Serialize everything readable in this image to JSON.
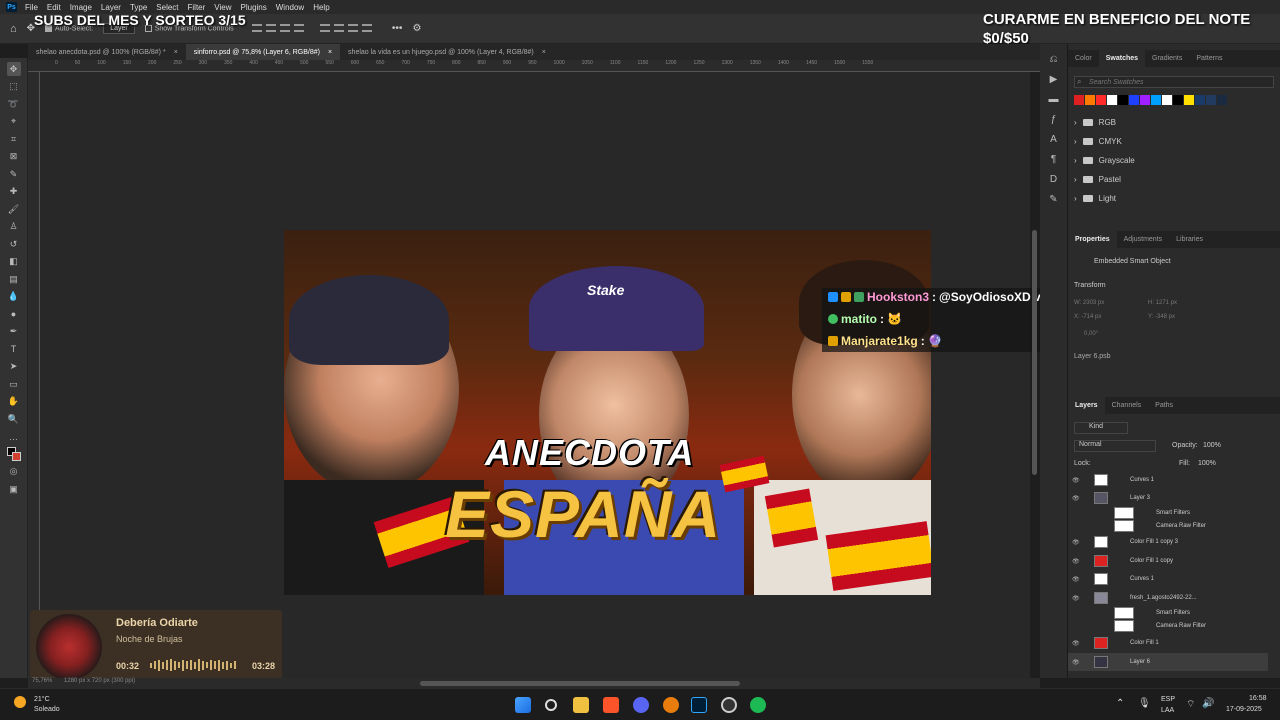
{
  "menubar": {
    "app_icon": "Ps",
    "items": [
      "File",
      "Edit",
      "Image",
      "Layer",
      "Type",
      "Select",
      "Filter",
      "View",
      "Plugins",
      "Window",
      "Help"
    ]
  },
  "options": {
    "auto_select": "Auto-Select:",
    "auto_select_target": "Layer",
    "show_transform": "Show Transform Controls"
  },
  "overlay": {
    "subs": "SUBS DEL MES Y SORTEO 3/15",
    "goal_title": "CURARME EN BENEFICIO DEL NOTE",
    "goal_progress": "$0/$50"
  },
  "tabs": [
    {
      "label": "shelao anecdota.psd @ 100% (RGB/8#) *",
      "active": false
    },
    {
      "label": "sinforro.psd @ 75,8% (Layer 6, RGB/8#)",
      "active": true
    },
    {
      "label": "shelao la vida es un hjuego.psd @ 100% (Layer 4, RGB/8#)",
      "active": false
    }
  ],
  "ruler": [
    "0",
    "50",
    "100",
    "150",
    "200",
    "250",
    "300",
    "350",
    "400",
    "450",
    "500",
    "550",
    "600",
    "650",
    "700",
    "750",
    "800",
    "850",
    "900",
    "950",
    "1000",
    "1050",
    "1100",
    "1150",
    "1200",
    "1250",
    "1300",
    "1350",
    "1400",
    "1450",
    "1500",
    "1550"
  ],
  "thumbnail": {
    "line1": "ANECDOTA",
    "line2": "ESPAÑA",
    "cap_logo": "Stake"
  },
  "chat": [
    {
      "user": "Hookston3",
      "sep": " : ",
      "message": "@SoyOdiosoXD valeu irmao",
      "color": "#ff9ad6"
    },
    {
      "user": "matito",
      "sep": " : ",
      "message": "🐱",
      "color": "#b6ffb0"
    },
    {
      "user": "Manjarate1kg",
      "sep": " : ",
      "message": "🔮",
      "color": "#ffe28a"
    }
  ],
  "music": {
    "title": "Debería Odiarte",
    "artist": "Noche de Brujas",
    "elapsed": "00:32",
    "duration": "03:28"
  },
  "status": {
    "zoom": "75,76%",
    "doc": "1280 px x 720 px (300 ppi)"
  },
  "panels": {
    "swatch_tabs": [
      "Color",
      "Swatches",
      "Gradients",
      "Patterns"
    ],
    "swatch_search": "Search Swatches",
    "swatch_colors": [
      "#e02020",
      "#ff7a00",
      "#ff2a2a",
      "#ffffff",
      "#000000",
      "#2040ff",
      "#a020ff",
      "#00a0ff",
      "#ffffff",
      "#000000",
      "#ffe000",
      "#1a3a6a",
      "#203a60",
      "#1a2a40"
    ],
    "swatch_folders": [
      "RGB",
      "CMYK",
      "Grayscale",
      "Pastel",
      "Light"
    ],
    "props_tabs": [
      "Properties",
      "Adjustments",
      "Libraries"
    ],
    "props_type": "Embedded Smart Object",
    "props_transform": "Transform",
    "props_w": "W: 2303 px",
    "props_h": "H: 1271 px",
    "props_x": "X: -714 px",
    "props_y": "Y: -348 px",
    "props_angle": "0,00°",
    "props_file": "Layer 6.psb",
    "layer_tabs": [
      "Layers",
      "Channels",
      "Paths"
    ],
    "layer_kind": "Kind",
    "blend_mode": "Normal",
    "opacity_label": "Opacity:",
    "opacity": "100%",
    "lock_label": "Lock:",
    "fill_label": "Fill:",
    "fill": "100%",
    "layers": [
      {
        "name": "Curves 1"
      },
      {
        "name": "Layer 3"
      },
      {
        "name": "Smart Filters"
      },
      {
        "name": "Camera Raw Filter"
      },
      {
        "name": "Color Fill 1 copy 3"
      },
      {
        "name": "Color Fill 1 copy"
      },
      {
        "name": "Curves 1"
      },
      {
        "name": "fresh_1.agosto2492-22..."
      },
      {
        "name": "Smart Filters"
      },
      {
        "name": "Camera Raw Filter"
      },
      {
        "name": "Color Fill 1"
      },
      {
        "name": "Layer 6"
      }
    ]
  },
  "taskbar": {
    "weather_temp": "21°C",
    "weather_text": "Soleado",
    "lang": "ESP",
    "lang2": "LAA",
    "time": "16:58",
    "date": "17-09-2025"
  }
}
